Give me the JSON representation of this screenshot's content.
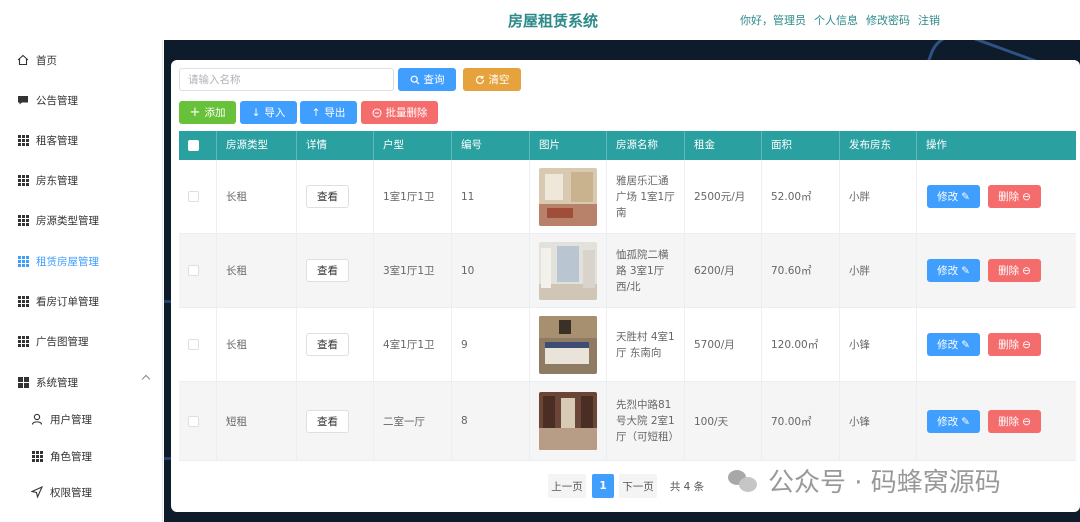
{
  "header": {
    "title": "房屋租赁系统",
    "greeting": "你好，管理员",
    "links": [
      "个人信息",
      "修改密码",
      "注销"
    ]
  },
  "sidebar": {
    "items": [
      {
        "label": "首页",
        "icon": "home-icon"
      },
      {
        "label": "公告管理",
        "icon": "message-icon"
      },
      {
        "label": "租客管理",
        "icon": "grid-icon"
      },
      {
        "label": "房东管理",
        "icon": "grid-icon"
      },
      {
        "label": "房源类型管理",
        "icon": "grid-icon"
      },
      {
        "label": "租赁房屋管理",
        "icon": "grid-icon",
        "active": true
      },
      {
        "label": "看房订单管理",
        "icon": "grid-icon"
      },
      {
        "label": "广告图管理",
        "icon": "grid-icon"
      },
      {
        "label": "系统管理",
        "icon": "menu-icon",
        "expanded": true
      },
      {
        "label": "用户管理",
        "icon": "user-icon"
      },
      {
        "label": "角色管理",
        "icon": "grid-icon"
      },
      {
        "label": "权限管理",
        "icon": "send-icon"
      }
    ]
  },
  "toolbar": {
    "search_placeholder": "请输入名称",
    "search_value": "",
    "query_label": "查询",
    "reset_label": "清空",
    "add_label": "添加",
    "import_label": "导入",
    "export_label": "导出",
    "batch_delete_label": "批量删除"
  },
  "table": {
    "columns": [
      "房源类型",
      "详情",
      "户型",
      "编号",
      "图片",
      "房源名称",
      "租金",
      "面积",
      "发布房东",
      "操作"
    ],
    "view_label": "查看",
    "edit_label": "修改",
    "delete_label": "删除",
    "rows": [
      {
        "type": "长租",
        "layout": "1室1厅1卫",
        "id": "11",
        "name": "雅居乐汇通广场 1室1厅南",
        "rent": "2500元/月",
        "area": "52.00㎡",
        "landlord": "小胖"
      },
      {
        "type": "长租",
        "layout": "3室1厅1卫",
        "id": "10",
        "name": "恤孤院二横路 3室1厅 西/北",
        "rent": "6200/月",
        "area": "70.60㎡",
        "landlord": "小胖"
      },
      {
        "type": "长租",
        "layout": "4室1厅1卫",
        "id": "9",
        "name": "天胜村 4室1厅 东南向",
        "rent": "5700/月",
        "area": "120.00㎡",
        "landlord": "小锋"
      },
      {
        "type": "短租",
        "layout": "二室一厅",
        "id": "8",
        "name": "先烈中路81号大院 2室1厅（可短租）",
        "rent": "100/天",
        "area": "70.00㎡",
        "landlord": "小锋"
      }
    ]
  },
  "pagination": {
    "prev_label": "上一页",
    "current_page": "1",
    "next_label": "下一页",
    "total_label": "共 4 条"
  },
  "watermark": {
    "text": "公众号 · 码蜂窝源码"
  },
  "colors": {
    "accent": "#2ba0a0",
    "primary": "#409eff",
    "danger": "#f56c6c",
    "warning": "#e6a23c",
    "success": "#67c23a"
  }
}
